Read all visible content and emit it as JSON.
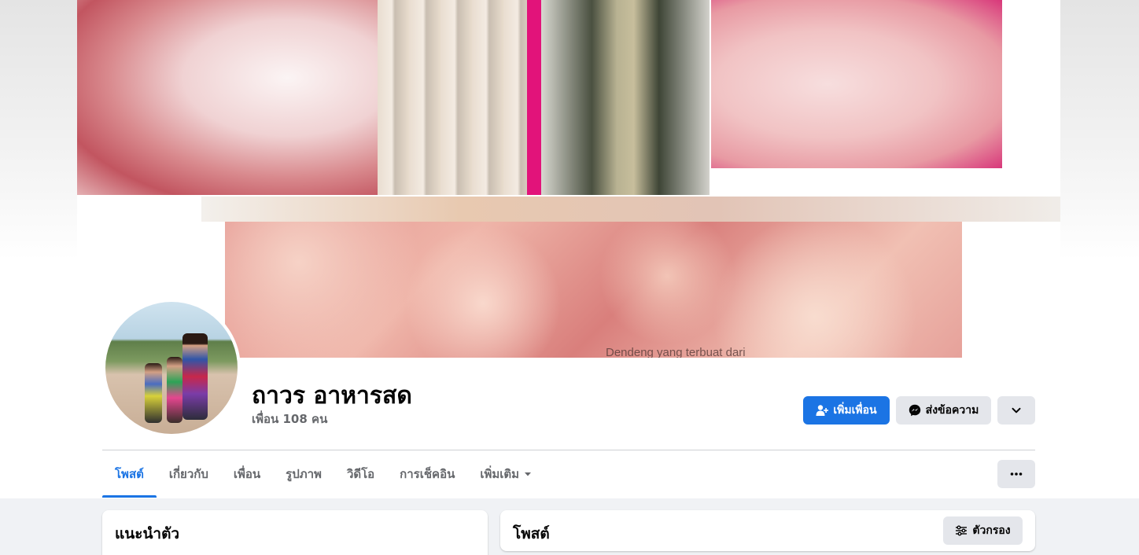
{
  "cover": {
    "caption": "Dendeng yang terbuat dari"
  },
  "profile": {
    "name": "ถาวร อาหารสด",
    "friends": "เพื่อน 108 คน"
  },
  "actions": {
    "add_friend": "เพิ่มเพื่อน",
    "message": "ส่งข้อความ"
  },
  "tabs": [
    {
      "label": "โพสต์",
      "active": true
    },
    {
      "label": "เกี่ยวกับ"
    },
    {
      "label": "เพื่อน"
    },
    {
      "label": "รูปภาพ"
    },
    {
      "label": "วิดีโอ"
    },
    {
      "label": "การเช็คอิน"
    },
    {
      "label": "เพิ่มเติม"
    }
  ],
  "intro": {
    "title": "แนะนำตัว"
  },
  "posts": {
    "title": "โพสต์",
    "filter_label": "ตัวกรอง"
  },
  "colors": {
    "accent": "#1b74e4",
    "secondary_button": "#e4e6eb",
    "muted_text": "#65676b",
    "background": "#f0f2f5"
  },
  "icons": [
    "add-friend-icon",
    "messenger-icon",
    "chevron-down-icon",
    "caret-down-icon",
    "ellipsis-icon",
    "filter-icon"
  ]
}
